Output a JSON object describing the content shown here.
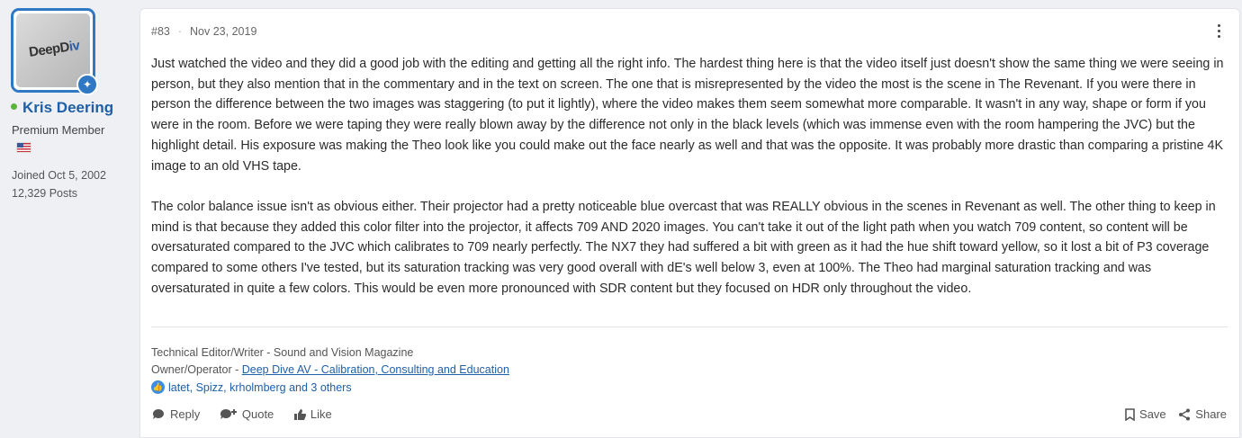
{
  "user": {
    "avatar_text_a": "DeepD",
    "avatar_text_b": "iv",
    "name": "Kris Deering",
    "title": "Premium Member",
    "joined": "Joined Oct 5, 2002",
    "posts": "12,329 Posts",
    "online_color": "#5ab33a"
  },
  "post": {
    "number": "#83",
    "date": "Nov 23, 2019",
    "paragraphs": [
      "Just watched the video and they did a good job with the editing and getting all the right info. The hardest thing here is that the video itself just doesn't show the same thing we were seeing in person, but they also mention that in the commentary and in the text on screen. The one that is misrepresented by the video the most is the scene in The Revenant. If you were there in person the difference between the two images was staggering (to put it lightly), where the video makes them seem somewhat more comparable. It wasn't in any way, shape or form if you were in the room. Before we were taping they were really blown away by the difference not only in the black levels (which was immense even with the room hampering the JVC) but the highlight detail. His exposure was making the Theo look like you could make out the face nearly as well and that was the opposite. It was probably more drastic than comparing a pristine 4K image to an old VHS tape.",
      "The color balance issue isn't as obvious either. Their projector had a pretty noticeable blue overcast that was REALLY obvious in the scenes in Revenant as well. The other thing to keep in mind is that because they added this color filter into the projector, it affects 709 AND 2020 images. You can't take it out of the light path when you watch 709 content, so content will be oversaturated compared to the JVC which calibrates to 709 nearly perfectly. The NX7 they had suffered a bit with green as it had the hue shift toward yellow, so it lost a bit of P3 coverage compared to some others I've tested, but its saturation tracking was very good overall with dE's well below 3, even at 100%. The Theo had marginal saturation tracking and was oversaturated in quite a few colors. This would be even more pronounced with SDR content but they focused on HDR only throughout the video."
    ],
    "signature": {
      "line1": "Technical Editor/Writer - Sound and Vision Magazine",
      "line2_prefix": "Owner/Operator - ",
      "line2_link": "Deep Dive AV - Calibration, Consulting and Education"
    },
    "reactions": "latet, Spizz, krholmberg and 3 others",
    "actions": {
      "reply": "Reply",
      "quote": "Quote",
      "like": "Like",
      "save": "Save",
      "share": "Share"
    }
  },
  "colors": {
    "accent": "#1f5fa7",
    "avatar_border": "#2f78c4"
  }
}
